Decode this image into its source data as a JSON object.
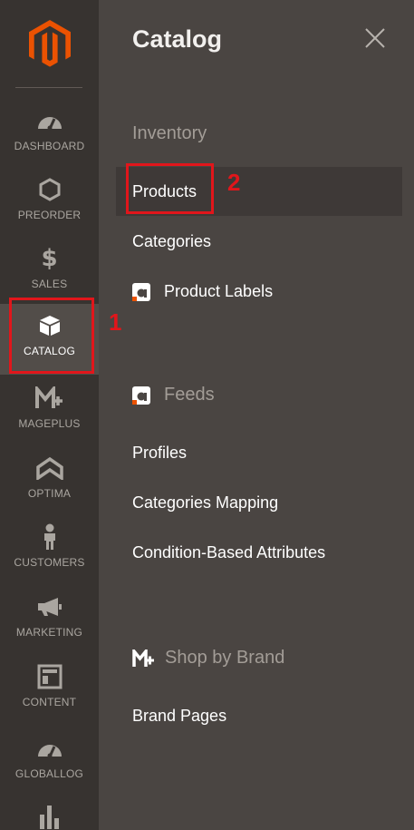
{
  "nav": {
    "items": [
      {
        "label": "DASHBOARD",
        "icon": "gauge-icon"
      },
      {
        "label": "PREORDER",
        "icon": "hexagon-icon"
      },
      {
        "label": "SALES",
        "icon": "dollar-icon"
      },
      {
        "label": "CATALOG",
        "icon": "box-icon",
        "active": true
      },
      {
        "label": "MAGEPLUS",
        "icon": "mageplus-icon"
      },
      {
        "label": "OPTIMA",
        "icon": "optima-icon"
      },
      {
        "label": "CUSTOMERS",
        "icon": "person-icon"
      },
      {
        "label": "MARKETING",
        "icon": "megaphone-icon"
      },
      {
        "label": "CONTENT",
        "icon": "layout-icon"
      },
      {
        "label": "GLOBALLOG",
        "icon": "gauge-icon"
      },
      {
        "label": "",
        "icon": "bar-chart-icon"
      }
    ]
  },
  "panel": {
    "title": "Catalog",
    "sections": [
      {
        "title": "Inventory",
        "items": [
          "Products",
          "Categories",
          "Product Labels"
        ]
      },
      {
        "title": "Feeds",
        "items": [
          "Profiles",
          "Categories Mapping",
          "Condition-Based Attributes"
        ]
      },
      {
        "title": "Shop by Brand",
        "items": [
          "Brand Pages"
        ]
      }
    ]
  },
  "annotations": {
    "step1": "1",
    "step2": "2"
  },
  "colors": {
    "rail_bg": "#373330",
    "panel_bg": "#4a4542",
    "active_nav_bg": "#524d49",
    "magento_orange": "#eb5202",
    "highlight_red": "#e1161b"
  }
}
